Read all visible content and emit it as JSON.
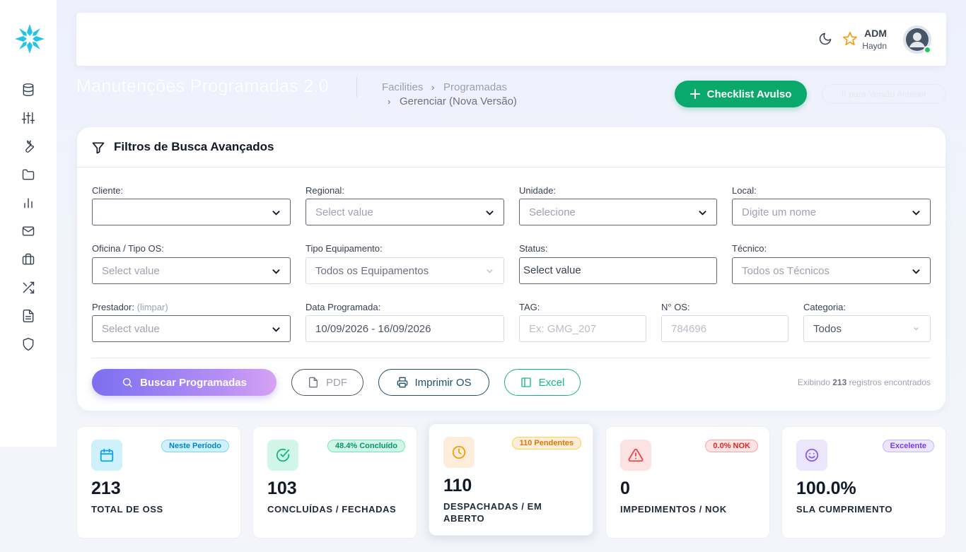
{
  "colors": {
    "accent_green": "#0aa86a",
    "accent_purple": "#7c6ff0",
    "logo_cyan": "#22c5e8"
  },
  "sidebar": {
    "items": [
      {
        "icon": "database-icon"
      },
      {
        "icon": "sliders-icon"
      },
      {
        "icon": "wrench-icon"
      },
      {
        "icon": "folder-icon"
      },
      {
        "icon": "bar-chart-icon"
      },
      {
        "icon": "mail-icon"
      },
      {
        "icon": "briefcase-icon"
      },
      {
        "icon": "shuffle-icon"
      },
      {
        "icon": "file-text-icon"
      },
      {
        "icon": "shield-icon"
      }
    ]
  },
  "header": {
    "user_role": "ADM",
    "user_name": "Haydn"
  },
  "page": {
    "title": "Manutenções Programadas 2.0",
    "breadcrumb": [
      "Facilities",
      "Programadas",
      "Gerenciar (Nova Versão)"
    ],
    "checklist_button": "Checklist Avulso",
    "old_version_button": "Ir para Versão Anterior"
  },
  "filters": {
    "title": "Filtros de Busca Avançados",
    "cliente": {
      "label": "Cliente:",
      "value": ""
    },
    "regional": {
      "label": "Regional:",
      "value": "Select value"
    },
    "unidade": {
      "label": "Unidade:",
      "value": "Selecione"
    },
    "local": {
      "label": "Local:",
      "value": "Digite um nome"
    },
    "oficina": {
      "label": "Oficina / Tipo OS:",
      "value": "Select value"
    },
    "tipo_equipamento": {
      "label": "Tipo Equipamento:",
      "value": "Todos os Equipamentos"
    },
    "status": {
      "label": "Status:",
      "value": "Select value"
    },
    "tecnico": {
      "label": "Técnico:",
      "value": "Todos os Técnicos"
    },
    "prestador": {
      "label": "Prestador:",
      "clear": "(limpar)",
      "value": "Select value"
    },
    "data_programada": {
      "label": "Data Programada:",
      "value": "10/09/2026 - 16/09/2026"
    },
    "tag": {
      "label": "TAG:",
      "placeholder": "Ex: GMG_207"
    },
    "n_os": {
      "label": "N° OS:",
      "placeholder": "784696"
    },
    "categoria": {
      "label": "Categoria:",
      "value": "Todos"
    },
    "buttons": {
      "search": "Buscar Programadas",
      "pdf": "PDF",
      "print": "Imprimir OS",
      "excel": "Excel"
    },
    "records": {
      "prefix": "Exibindo",
      "count": "213",
      "suffix": "registros encontrados"
    }
  },
  "stats": [
    {
      "value": "213",
      "label": "TOTAL DE OSS",
      "badge": "Neste Período",
      "icon": "calendar-icon",
      "color": "#0ea5e9"
    },
    {
      "value": "103",
      "label": "CONCLUÍDAS / FECHADAS",
      "badge": "48.4% Concluído",
      "icon": "check-circle-icon",
      "color": "#10b981"
    },
    {
      "value": "110",
      "label": "DESPACHADAS / EM ABERTO",
      "badge": "110 Pendentes",
      "icon": "clock-icon",
      "color": "#f59e0b"
    },
    {
      "value": "0",
      "label": "IMPEDIMENTOS / NOK",
      "badge": "0.0% NOK",
      "icon": "alert-triangle-icon",
      "color": "#ef4444"
    },
    {
      "value": "100.0%",
      "label": "SLA CUMPRIMENTO",
      "badge": "Excelente",
      "icon": "smile-icon",
      "color": "#8b5cf6"
    }
  ]
}
